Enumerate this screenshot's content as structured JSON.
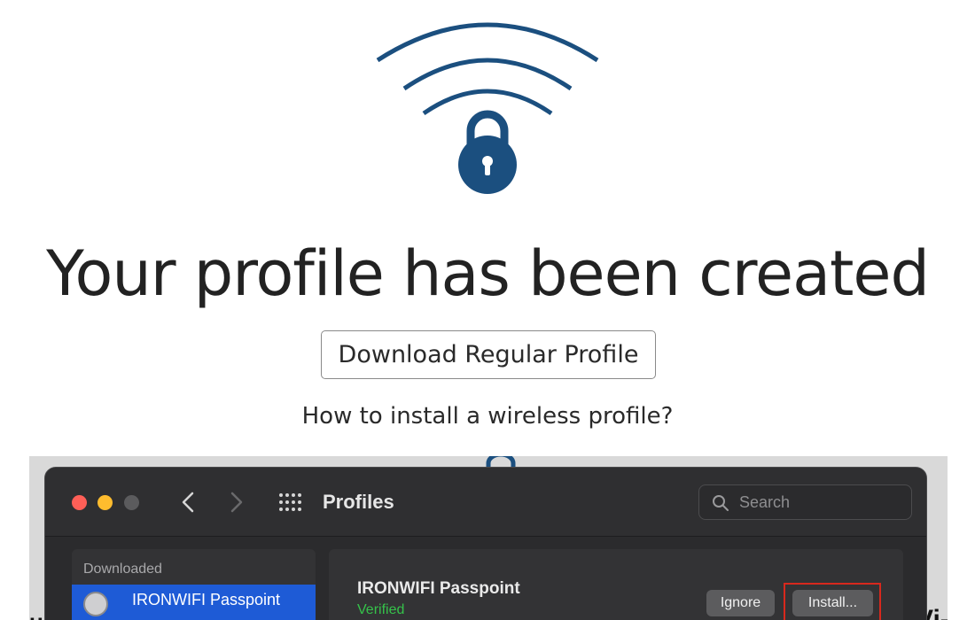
{
  "colors": {
    "brand": "#1b4f7f",
    "install_highlight": "#d8281d",
    "verified": "#35c24a",
    "selection": "#1e5bd6"
  },
  "hero": {
    "icon": "wifi-lock-icon",
    "headline": "Your profile has been created",
    "download_button": "Download Regular Profile",
    "help_link": "How to install a wireless profile?"
  },
  "screenshot": {
    "edge_left_text": "u",
    "edge_right_text": "Vi-",
    "window": {
      "title": "Profiles",
      "search_placeholder": "Search",
      "icons": [
        "close-traffic-light",
        "minimize-traffic-light",
        "zoom-traffic-light",
        "chevron-left-icon",
        "chevron-right-icon",
        "grid-icon",
        "search-icon"
      ],
      "sidebar": {
        "header": "Downloaded",
        "items": [
          {
            "label": "IRONWIFI Passpoint",
            "selected": true
          }
        ]
      },
      "detail": {
        "profile_name": "IRONWIFI Passpoint",
        "status": "Verified",
        "ignore_button": "Ignore",
        "install_button": "Install..."
      }
    }
  }
}
